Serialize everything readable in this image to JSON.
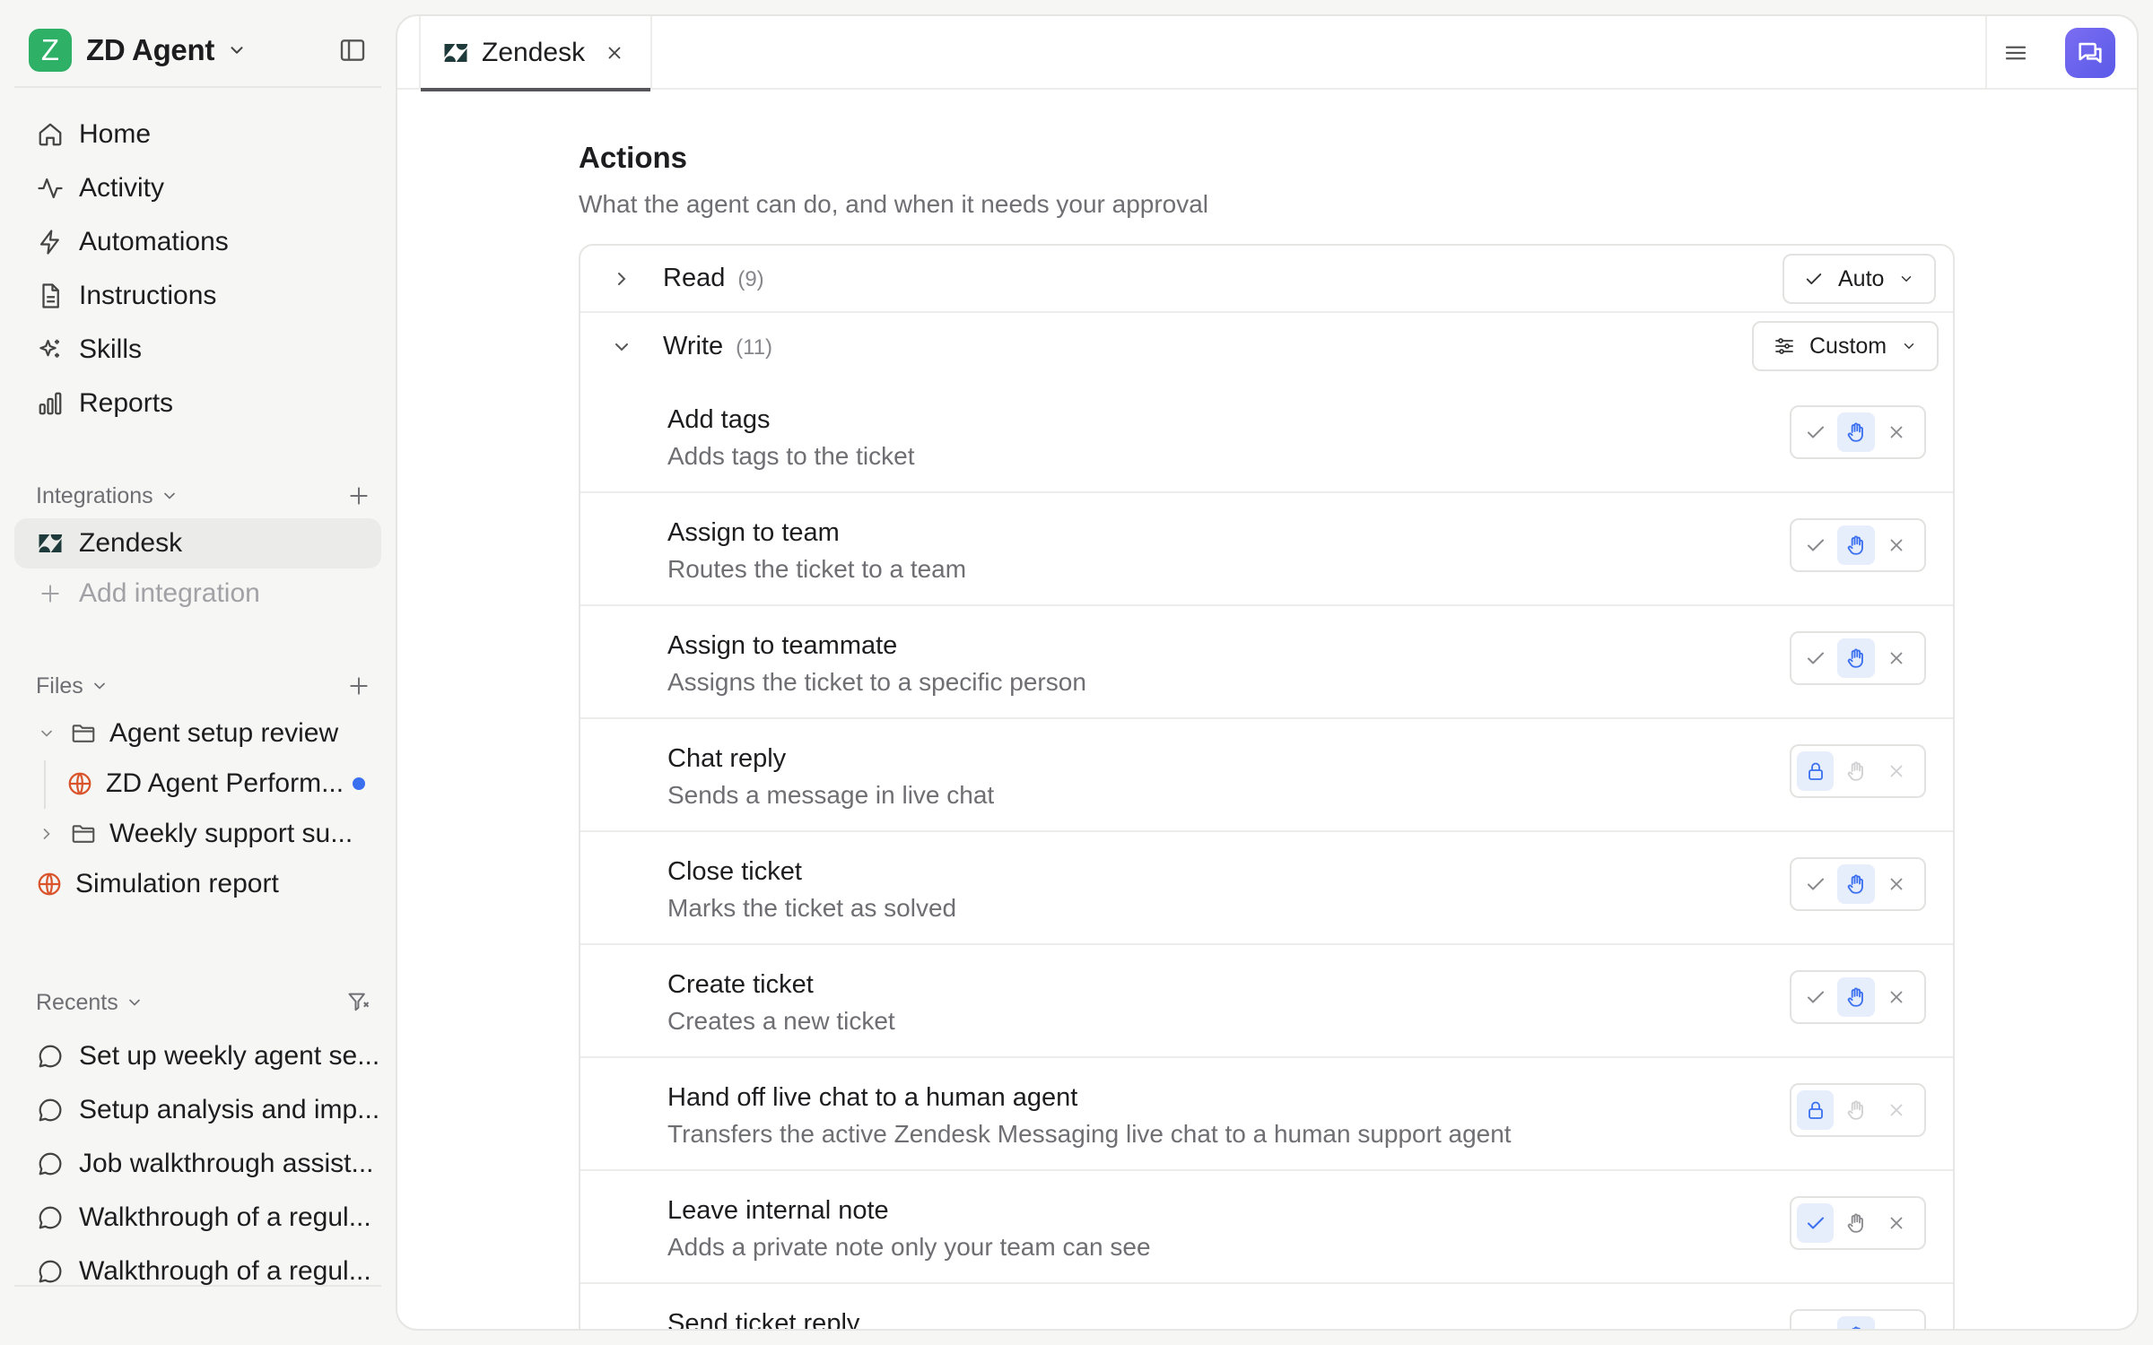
{
  "workspace": {
    "badge": "Z",
    "name": "ZD Agent"
  },
  "nav": [
    {
      "label": "Home"
    },
    {
      "label": "Activity"
    },
    {
      "label": "Automations"
    },
    {
      "label": "Instructions"
    },
    {
      "label": "Skills"
    },
    {
      "label": "Reports"
    }
  ],
  "integrations": {
    "label": "Integrations",
    "items": [
      {
        "label": "Zendesk",
        "active": true
      }
    ],
    "add_label": "Add integration"
  },
  "files": {
    "label": "Files",
    "folder1": "Agent setup review",
    "folder1_child": "ZD Agent Perform...",
    "folder2": "Weekly support su...",
    "report": "Simulation report"
  },
  "recents": {
    "label": "Recents",
    "items": [
      {
        "label": "Set up weekly agent se..."
      },
      {
        "label": "Setup analysis and imp..."
      },
      {
        "label": "Job walkthrough assist..."
      },
      {
        "label": "Walkthrough of a regul..."
      },
      {
        "label": "Walkthrough of a regul..."
      }
    ]
  },
  "tab": {
    "label": "Zendesk"
  },
  "actions": {
    "title": "Actions",
    "subtitle": "What the agent can do, and when it needs your approval",
    "read": {
      "label": "Read",
      "count": "(9)",
      "mode": "Auto"
    },
    "write": {
      "label": "Write",
      "count": "(11)",
      "mode": "Custom"
    },
    "items": [
      {
        "name": "Add tags",
        "desc": "Adds tags to the ticket",
        "state": "ask"
      },
      {
        "name": "Assign to team",
        "desc": "Routes the ticket to a team",
        "state": "ask"
      },
      {
        "name": "Assign to teammate",
        "desc": "Assigns the ticket to a specific person",
        "state": "ask"
      },
      {
        "name": "Chat reply",
        "desc": "Sends a message in live chat",
        "state": "locked"
      },
      {
        "name": "Close ticket",
        "desc": "Marks the ticket as solved",
        "state": "ask"
      },
      {
        "name": "Create ticket",
        "desc": "Creates a new ticket",
        "state": "ask"
      },
      {
        "name": "Hand off live chat to a human agent",
        "desc": "Transfers the active Zendesk Messaging live chat to a human support agent",
        "state": "locked"
      },
      {
        "name": "Leave internal note",
        "desc": "Adds a private note only your team can see",
        "state": "allow"
      },
      {
        "name": "Send ticket reply",
        "desc": "",
        "state": "ask"
      }
    ]
  },
  "colors": {
    "brand": "#2eb067",
    "accent": "#3a6ff0",
    "chat_button": "#6a62ee"
  }
}
